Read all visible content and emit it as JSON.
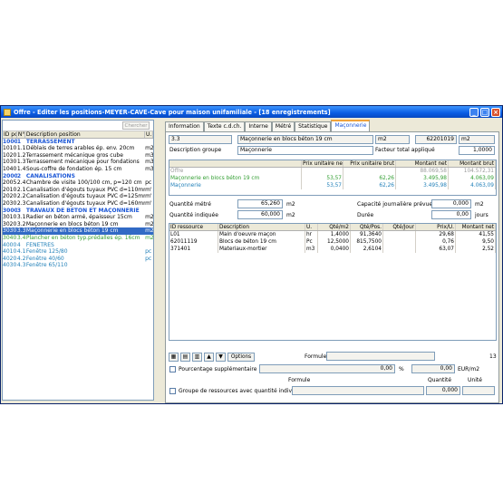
{
  "window": {
    "title": "Offre - Editer les positions-MEYER-CAVE-Cave pour maison unifamiliale - [18 enregistrements]",
    "minimize": "_",
    "maximize": "□",
    "close": "×"
  },
  "left": {
    "search_button": "Chercher",
    "columns": [
      "ID po",
      "N°pl",
      "Description position",
      "U."
    ],
    "rows": [
      {
        "id": "1000",
        "no": "1",
        "desc": "TERRASSEMENT",
        "unit": "",
        "style": "blue"
      },
      {
        "id": "1010",
        "no": "1.1",
        "desc": "Déblais de terres arables ép. env. 20cm",
        "unit": "m2",
        "style": ""
      },
      {
        "id": "1020",
        "no": "1.2",
        "desc": "Terrassement mécanique gros cube",
        "unit": "m3",
        "style": ""
      },
      {
        "id": "1030",
        "no": "1.3",
        "desc": "Terrassement mécanique pour fondations",
        "unit": "m3",
        "style": ""
      },
      {
        "id": "1040",
        "no": "1.4",
        "desc": "Sous-coffre de fondation ép. 15 cm",
        "unit": "m3",
        "style": ""
      },
      {
        "id": "2000",
        "no": "2",
        "desc": "CANALISATIONS",
        "unit": "",
        "style": "blue"
      },
      {
        "id": "2005",
        "no": "2.4",
        "desc": "Chambre de visite 100/100 cm, p=120 cm",
        "unit": "pc",
        "style": ""
      },
      {
        "id": "2010",
        "no": "2.1",
        "desc": "Canalisation d'égouts tuyaux PVC d=110mm",
        "unit": "m'",
        "style": ""
      },
      {
        "id": "2020",
        "no": "2.2",
        "desc": "Canalisation d'égouts tuyaux PVC d=125mm",
        "unit": "m'",
        "style": ""
      },
      {
        "id": "2030",
        "no": "2.3",
        "desc": "Canalisation d'égouts tuyaux PVC d=160mm",
        "unit": "m'",
        "style": ""
      },
      {
        "id": "3000",
        "no": "3",
        "desc": "TRAVAUX DE BÉTON ET MAÇONNERIE",
        "unit": "",
        "style": "blue"
      },
      {
        "id": "3010",
        "no": "3.1",
        "desc": "Radier en béton armé, épaisseur 15cm",
        "unit": "m2",
        "style": ""
      },
      {
        "id": "3020",
        "no": "3.2",
        "desc": "Maçonnerie en blocs béton 19 cm",
        "unit": "m2",
        "style": ""
      },
      {
        "id": "3030",
        "no": "3.3",
        "desc": "Maçonnerie en blocs béton 19 cm",
        "unit": "m2",
        "style": "sel"
      },
      {
        "id": "3040",
        "no": "3.4",
        "desc": "Plancher en béton typ.prédalles ép. 16cm",
        "unit": "m2",
        "style": "green"
      },
      {
        "id": "4000",
        "no": "4",
        "desc": "FENÊTRES",
        "unit": "",
        "style": "teal"
      },
      {
        "id": "4010",
        "no": "4.1",
        "desc": "Fenêtre 125/80",
        "unit": "pc",
        "style": "teal"
      },
      {
        "id": "4020",
        "no": "4.2",
        "desc": "Fenêtre 40/60",
        "unit": "pc",
        "style": "teal"
      },
      {
        "id": "4030",
        "no": "4.3",
        "desc": "Fenêtre 65/110",
        "unit": "",
        "style": "teal"
      }
    ]
  },
  "tabs": [
    "Information",
    "Texte c.d.ch.",
    "Interne",
    "Métré",
    "Statistique",
    "Maçonnerie"
  ],
  "form": {
    "pos_no": "3.3",
    "pos_desc": "Maçonnerie en blocs béton 19 cm",
    "unit": "m2",
    "code": "62201019",
    "unit2": "m2",
    "group_label": "Description groupe",
    "group_value": "Maçonnerie",
    "factor_label": "Facteur total appliqué",
    "factor_value": "1,0000"
  },
  "summary": {
    "headers": [
      "",
      "Prix unitaire net",
      "Prix unitaire brut",
      "Montant net",
      "Montant brut"
    ],
    "rows": [
      {
        "label": "Offre",
        "pun": "",
        "pub": "",
        "mn": "88.069,58",
        "mb": "104.572,31",
        "style": "gray"
      },
      {
        "label": "Maçonnerie en blocs béton 19 cm",
        "pun": "53,57",
        "pub": "62,26",
        "mn": "3.495,98",
        "mb": "4.063,09",
        "style": "grn"
      },
      {
        "label": "Maçonnerie",
        "pun": "53,57",
        "pub": "62,26",
        "mn": "3.495,98",
        "mb": "4.063,09",
        "style": "tealc"
      }
    ]
  },
  "qty": {
    "metre_label": "Quantité métré",
    "metre_value": "65,260",
    "metre_unit": "m2",
    "ind_label": "Quantité indiquée",
    "ind_value": "60,000",
    "ind_unit": "m2",
    "cap_label": "Capacité journalière prévue",
    "cap_value": "0,000",
    "cap_unit": "m2",
    "dur_label": "Durée",
    "dur_value": "0,00",
    "dur_unit": "jours"
  },
  "resources": {
    "headers": [
      "ID ressource",
      "Description",
      "U.",
      "Qté/m2",
      "Qté/Pos.",
      "Qté/Jour",
      "Prix/U.",
      "Montant net"
    ],
    "rows": [
      {
        "id": "L01",
        "desc": "Main d'oeuvre maçon",
        "u": "hr",
        "q1": "1,4000",
        "q2": "91,3640",
        "q3": "",
        "pu": "29,68",
        "mn": "41,55"
      },
      {
        "id": "62011119",
        "desc": "Blocs de béton 19 cm",
        "u": "Pc",
        "q1": "12,5000",
        "q2": "815,7500",
        "q3": "",
        "pu": "0,76",
        "mn": "9,50"
      },
      {
        "id": "371401",
        "desc": "Materiaux-mortier",
        "u": "m3",
        "q1": "0,0400",
        "q2": "2,6104",
        "q3": "",
        "pu": "63,07",
        "mn": "2,52"
      }
    ]
  },
  "toolbar": {
    "options": "Options",
    "formule_label": "Formule",
    "count": "13"
  },
  "footer": {
    "pct_label": "Pourcentage supplémentaire",
    "pct_value": "0,00",
    "pct_unit": "%",
    "eur_value": "0,00",
    "eur_unit": "EUR/m2",
    "formule": "Formule",
    "quantite": "Quantité",
    "unite": "Unité",
    "group_label": "Groupe de ressources avec quantité individuelle",
    "group_value": "0,000"
  }
}
